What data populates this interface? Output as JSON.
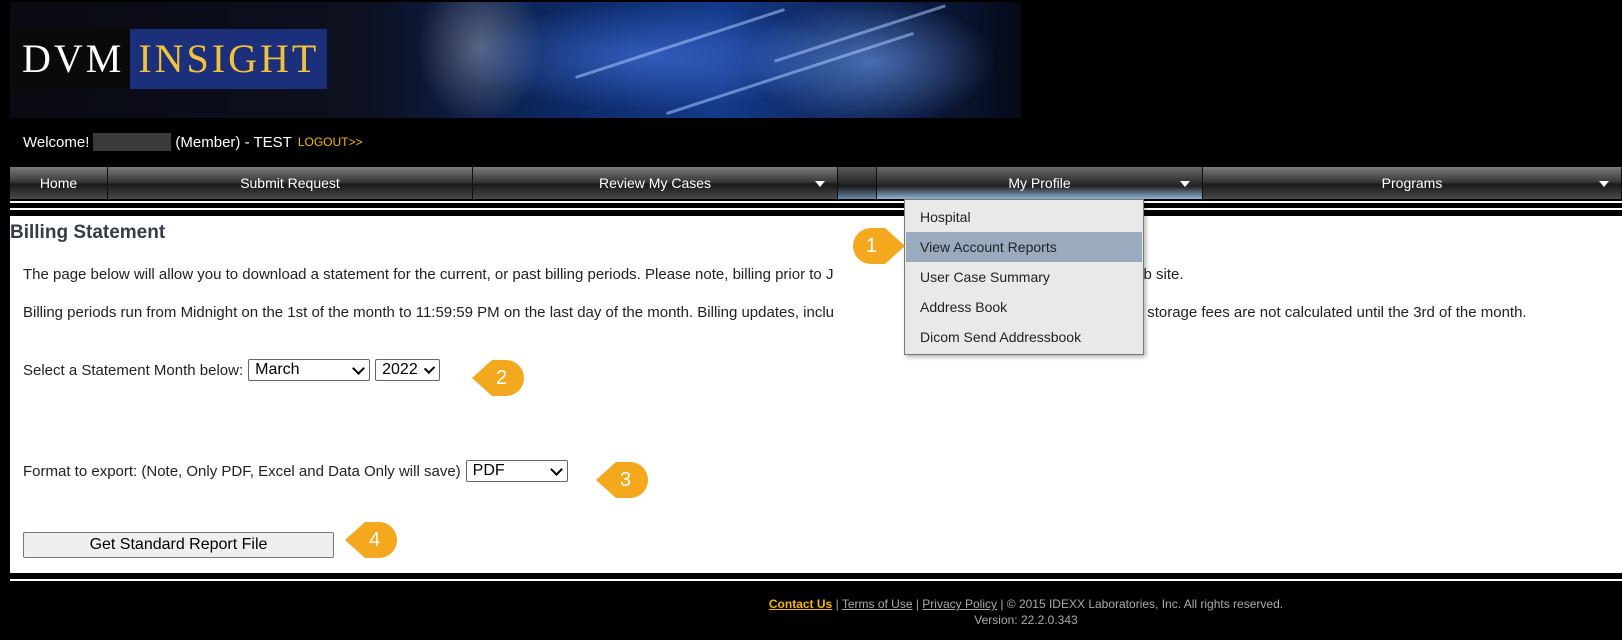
{
  "banner": {
    "logo_part1": "DVM",
    "logo_part2": "INSIGHT"
  },
  "welcome": {
    "greeting": "Welcome!",
    "role": "(Member) - TEST",
    "logout": "LOGOUT>>"
  },
  "nav": {
    "items": [
      {
        "label": "Home"
      },
      {
        "label": "Submit Request"
      },
      {
        "label": "Review My Cases"
      },
      {
        "label": "My Profile"
      },
      {
        "label": "Programs"
      }
    ]
  },
  "profile_menu": {
    "items": [
      {
        "label": "Hospital"
      },
      {
        "label": "View Account Reports"
      },
      {
        "label": "User Case Summary"
      },
      {
        "label": "Address Book"
      },
      {
        "label": "Dicom Send Addressbook"
      }
    ]
  },
  "main": {
    "title": "Billing Statement",
    "para1_a": "The page below will allow you to download a statement for the current, or past billing periods.  Please note, billing prior to J",
    "para1_b": "his web site.",
    "para2_a": "Billing periods run from Midnight on the 1st of the month to 11:59:59 PM on the last day of the month. Billing updates, inclu",
    "para2_b": "and storage fees are not calculated until the 3rd of the month.",
    "month_label": "Select a Statement Month below:",
    "month_value": "March",
    "year_value": "2022",
    "format_label": "Format to export: (Note, Only PDF, Excel and Data Only will save)",
    "format_value": "PDF",
    "button_label": "Get Standard Report File"
  },
  "callouts": [
    "1",
    "2",
    "3",
    "4"
  ],
  "footer": {
    "contact": "Contact Us",
    "sep1": " | ",
    "terms": "Terms of Use",
    "sep2": " | ",
    "privacy": "Privacy Policy",
    "copyright": " | © 2015 IDEXX Laboratories, Inc. All rights reserved.",
    "version": "Version: 22.2.0.343"
  },
  "colors": {
    "accent": "#f5b800",
    "callout": "#f4a81d",
    "menu_hover": "#9aabbf"
  }
}
